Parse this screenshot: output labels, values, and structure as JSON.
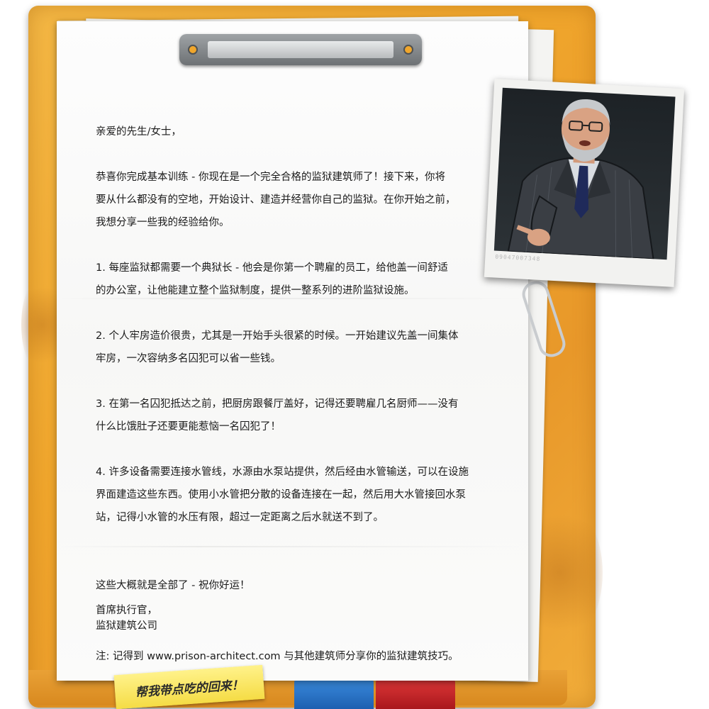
{
  "letter": {
    "greeting": "亲爱的先生/女士，",
    "intro": [
      "恭喜你完成基本训练 - 你现在是一个完全合格的监狱建筑师了！接下来，你将",
      "要从什么都没有的空地，开始设计、建造并经营你自己的监狱。在你开始之前，",
      "我想分享一些我的经验给你。"
    ],
    "tips": [
      {
        "lines": [
          "1. 每座监狱都需要一个典狱长 - 他会是你第一个聘雇的员工，给他盖一间舒适",
          "的办公室，让他能建立整个监狱制度，提供一整系列的进阶监狱设施。"
        ]
      },
      {
        "lines": [
          "2. 个人牢房造价很贵，尤其是一开始手头很紧的时候。一开始建议先盖一间集体",
          "牢房，一次容纳多名囚犯可以省一些钱。"
        ]
      },
      {
        "lines": [
          "3. 在第一名囚犯抵达之前，把厨房跟餐厅盖好，记得还要聘雇几名厨师——没有",
          "什么比饿肚子还要更能惹恼一名囚犯了！"
        ]
      },
      {
        "lines": [
          "4. 许多设备需要连接水管线，水源由水泵站提供，然后经由水管输送，可以在设施",
          "界面建造这些东西。使用小水管把分散的设备连接在一起，然后用大水管接回水泵",
          "站，记得小水管的水压有限，超过一定距离之后水就送不到了。"
        ]
      }
    ],
    "closing": "这些大概就是全部了 - 祝你好运！",
    "signature_title": "首席执行官，",
    "signature_company": "监狱建筑公司",
    "note": "注: 记得到 www.prison-architect.com 与其他建筑师分享你的监狱建筑技巧。"
  },
  "photo": {
    "caption": "09047007348"
  },
  "sticky_note": {
    "text": "帮我带点吃的回来！"
  },
  "colors": {
    "folder": "#f0a62c",
    "tab_blue": "#2a74c8",
    "tab_red": "#c8242a",
    "paper": "#f9f9f8",
    "sticky": "#f8e560"
  }
}
